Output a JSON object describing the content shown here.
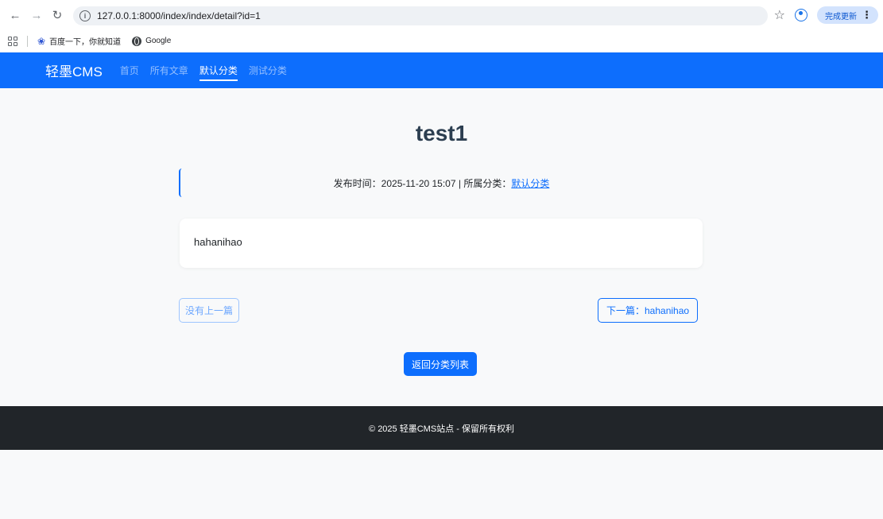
{
  "browser": {
    "url": "127.0.0.1:8000/index/index/detail?id=1",
    "update_label": "完成更新",
    "bookmarks": [
      {
        "label": "百度一下，你就知道",
        "icon": "paw-icon"
      },
      {
        "label": "Google",
        "icon": "globe-icon"
      }
    ]
  },
  "navbar": {
    "brand": "轻墨CMS",
    "links": [
      {
        "label": "首页"
      },
      {
        "label": "所有文章"
      },
      {
        "label": "默认分类",
        "active": true
      },
      {
        "label": "测试分类"
      }
    ]
  },
  "article": {
    "title": "test1",
    "meta_prefix": "发布时间：",
    "date": "2025-11-20 15:07",
    "meta_mid": " | 所属分类：",
    "category": "默认分类",
    "body": "hahanihao"
  },
  "pager": {
    "prev_label": "没有上一篇",
    "next_label": "下一篇：hahanihao",
    "back_label": "返回分类列表"
  },
  "footer": {
    "text": "© 2025 轻墨CMS站点 - 保留所有权利"
  },
  "colors": {
    "primary": "#0d6efd",
    "footer_bg": "#212529",
    "page_bg": "#f8f9fa"
  }
}
